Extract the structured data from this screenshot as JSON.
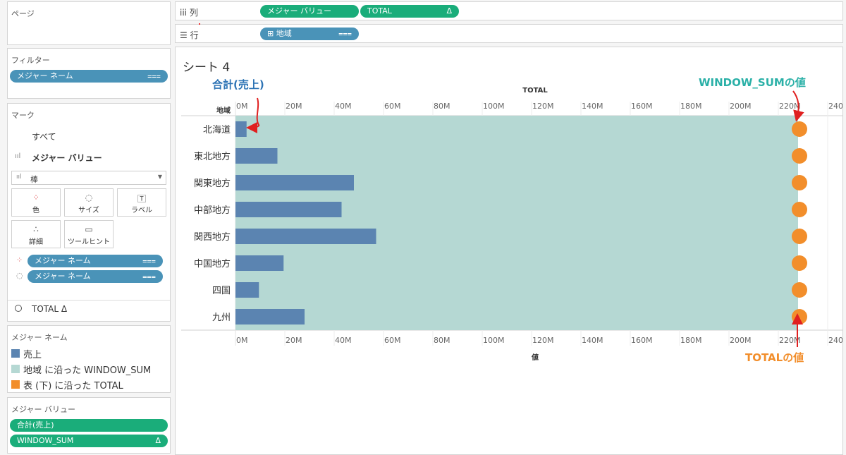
{
  "pages_pane": {
    "title": "ページ"
  },
  "filters_pane": {
    "title": "フィルター",
    "pill": "メジャー ネーム"
  },
  "marks_pane": {
    "title": "マーク",
    "all": "すべて",
    "measure_values": "メジャー バリュー",
    "mark_type": "棒",
    "cards": {
      "color": "色",
      "size": "サイズ",
      "label": "ラベル",
      "detail": "詳細",
      "tooltip": "ツールヒント"
    },
    "pills": [
      "メジャー ネーム",
      "メジャー ネーム"
    ],
    "total": "TOTAL Δ"
  },
  "legend_pane": {
    "title": "メジャー ネーム",
    "items": [
      {
        "label": "売上",
        "color": "#5b84b1"
      },
      {
        "label": "地域 に沿った WINDOW_SUM",
        "color": "#b5d8d3"
      },
      {
        "label": "表 (下) に沿った TOTAL",
        "color": "#f28e2b"
      }
    ]
  },
  "measure_values_pane": {
    "title": "メジャー バリュー",
    "pills": [
      "合計(売上)",
      "WINDOW_SUM"
    ],
    "delta": "Δ"
  },
  "shelves": {
    "columns": {
      "label": "iii 列",
      "pill1": "メジャー バリュー",
      "pill2": "TOTAL",
      "pill2_delta": "Δ"
    },
    "rows": {
      "label": "☰ 行",
      "pill": "⊞ 地域"
    }
  },
  "sheet": {
    "title": "シート 4"
  },
  "annotations": {
    "sum_sales": "合計(売上)",
    "window_sum": "WINDOW_SUMの値",
    "total": "TOTALの値"
  },
  "chart_data": {
    "type": "bar",
    "top_axis_title": "TOTAL",
    "bottom_axis_title": "値",
    "row_header": "地域",
    "ticks": [
      "0M",
      "20M",
      "40M",
      "60M",
      "80M",
      "100M",
      "120M",
      "140M",
      "160M",
      "180M",
      "200M",
      "220M",
      "240M"
    ],
    "xlim": [
      0,
      240
    ],
    "categories": [
      "北海道",
      "東北地方",
      "関東地方",
      "中部地方",
      "関西地方",
      "中国地方",
      "四国",
      "九州"
    ],
    "series": [
      {
        "name": "売上",
        "values": [
          4.5,
          17,
          48,
          43,
          57,
          19.5,
          9.5,
          28
        ],
        "color": "#5b84b1"
      },
      {
        "name": "地域 に沿った WINDOW_SUM",
        "values": [
          228,
          228,
          228,
          228,
          228,
          228,
          228,
          228
        ],
        "color": "#b5d8d3"
      },
      {
        "name": "表 (下) に沿った TOTAL",
        "values": [
          228,
          228,
          228,
          228,
          228,
          228,
          228,
          228
        ],
        "color": "#f28e2b"
      }
    ],
    "grid": true
  }
}
